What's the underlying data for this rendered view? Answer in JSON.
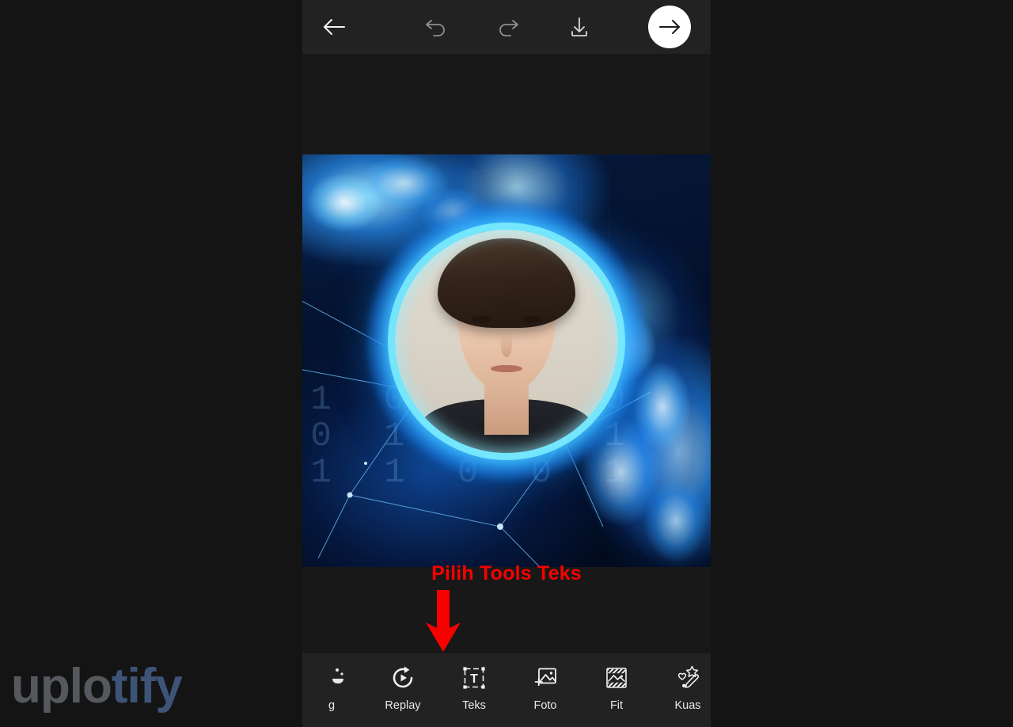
{
  "app": {
    "background_color": "#141414",
    "panel_color": "#181818",
    "bar_color": "#222222"
  },
  "topbar": {
    "buttons": [
      {
        "name": "back",
        "icon": "arrow-left-icon",
        "label": "Kembali"
      },
      {
        "name": "undo",
        "icon": "undo-icon",
        "label": "Undo"
      },
      {
        "name": "redo",
        "icon": "redo-icon",
        "label": "Redo"
      },
      {
        "name": "save",
        "icon": "download-icon",
        "label": "Simpan"
      },
      {
        "name": "next",
        "icon": "arrow-right-icon",
        "label": "Lanjut"
      }
    ]
  },
  "canvas": {
    "image_alt": "Foto potret pria dalam bingkai lingkaran bercahaya biru dengan latar api biru dan jaringan digital",
    "binary_text": "1 0 1 1 0\n0 1 1 0 1\n1 1 0 0 1"
  },
  "annotation": {
    "text": "Pilih Tools Teks",
    "color": "#f90000",
    "arrow": "arrow-down-annotation"
  },
  "toolbar": {
    "items": [
      {
        "label": "g",
        "icon": "bg-icon",
        "active": false
      },
      {
        "label": "Replay",
        "icon": "replay-icon",
        "active": false
      },
      {
        "label": "Teks",
        "icon": "text-icon",
        "active": true
      },
      {
        "label": "Foto",
        "icon": "photo-add-icon",
        "active": false
      },
      {
        "label": "Fit",
        "icon": "fit-icon",
        "active": false
      },
      {
        "label": "Kuas",
        "icon": "brush-icon",
        "active": false
      }
    ]
  },
  "watermark": {
    "part1": "uplo",
    "part2": "tify",
    "color1": "#55595e",
    "color2": "#3d5477"
  }
}
